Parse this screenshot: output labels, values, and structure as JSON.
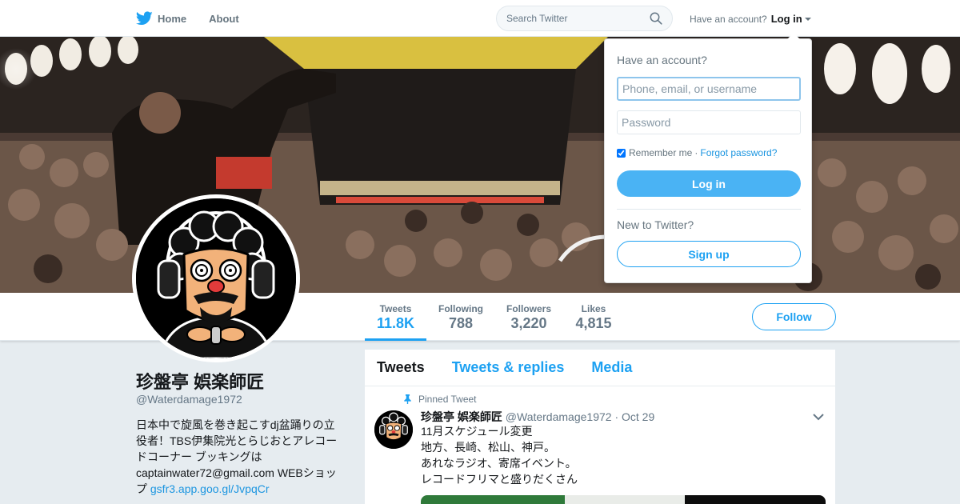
{
  "nav": {
    "home_label": "Home",
    "about_label": "About",
    "search_placeholder": "Search Twitter",
    "account_prompt": "Have an account?",
    "login_label": "Log in"
  },
  "colors": {
    "brand": "#1da1f2",
    "text_primary": "#14171a",
    "text_secondary": "#657786",
    "page_bg": "#e6ecf0"
  },
  "stats": [
    {
      "label": "Tweets",
      "value": "11.8K",
      "active": true
    },
    {
      "label": "Following",
      "value": "788",
      "active": false
    },
    {
      "label": "Followers",
      "value": "3,220",
      "active": false
    },
    {
      "label": "Likes",
      "value": "4,815",
      "active": false
    }
  ],
  "profile": {
    "follow_label": "Follow",
    "name": "珍盤亭 娯楽師匠",
    "handle": "@Waterdamage1972",
    "bio_lines": [
      "日本中で旋風を巻き起こすdj盆踊りの立",
      "役者！TBS伊集院光とらじおとアレコー",
      "ドコーナー ブッキングは",
      "captainwater72@gmail.com WEBショッ"
    ],
    "bio_last_prefix": "プ",
    "bio_link": "gsfr3.app.goo.gl/JvpqCr"
  },
  "timeline": {
    "tabs": [
      "Tweets",
      "Tweets & replies",
      "Media"
    ],
    "pinned_label": "Pinned Tweet",
    "tweet": {
      "name": "珍盤亭 娯楽師匠",
      "handle": "@Waterdamage1972",
      "separator": "·",
      "date": "Oct 29",
      "lines": [
        "11月スケジュール変更",
        "地方、長崎、松山、神戸。",
        "あれなラジオ、寄席イベント。",
        "レコードフリマと盛りだくさん"
      ]
    }
  },
  "login_dropdown": {
    "title": "Have an account?",
    "username_placeholder": "Phone, email, or username",
    "password_placeholder": "Password",
    "remember_label": "Remember me",
    "separator": "·",
    "forgot_label": "Forgot password?",
    "login_button": "Log in",
    "new_prompt": "New to Twitter?",
    "signup_button": "Sign up",
    "remember_checked": true
  },
  "icons": {
    "logo": "twitter-bird-icon",
    "search": "magnifier-icon",
    "pin": "pin-icon",
    "chevron": "chevron-down-icon"
  }
}
